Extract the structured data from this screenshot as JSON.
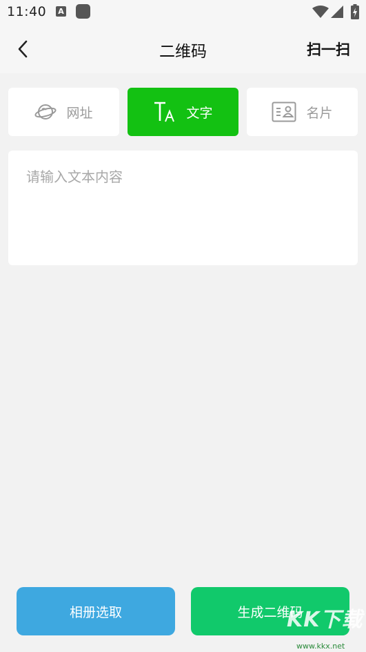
{
  "status_bar": {
    "time": "11:40",
    "app_icon_letter": "A",
    "icons": [
      "wifi-icon",
      "signal-icon",
      "battery-charging-icon"
    ]
  },
  "header": {
    "title": "二维码",
    "back_icon": "chevron-left-icon",
    "scan_label": "扫一扫"
  },
  "tabs": [
    {
      "label": "网址",
      "icon": "planet-icon",
      "active": false
    },
    {
      "label": "文字",
      "icon": "text-size-icon",
      "active": true
    },
    {
      "label": "名片",
      "icon": "contact-card-icon",
      "active": false
    }
  ],
  "text_input": {
    "placeholder": "请输入文本内容",
    "value": ""
  },
  "actions": {
    "album_label": "相册选取",
    "generate_label": "生成二维码"
  },
  "watermark": {
    "text": "KK下载",
    "url": "www.kkx.net"
  },
  "colors": {
    "active_tab": "#13c112",
    "album_button": "#3ea8e0",
    "generate_button": "#11c96b",
    "background": "#f2f2f2"
  }
}
